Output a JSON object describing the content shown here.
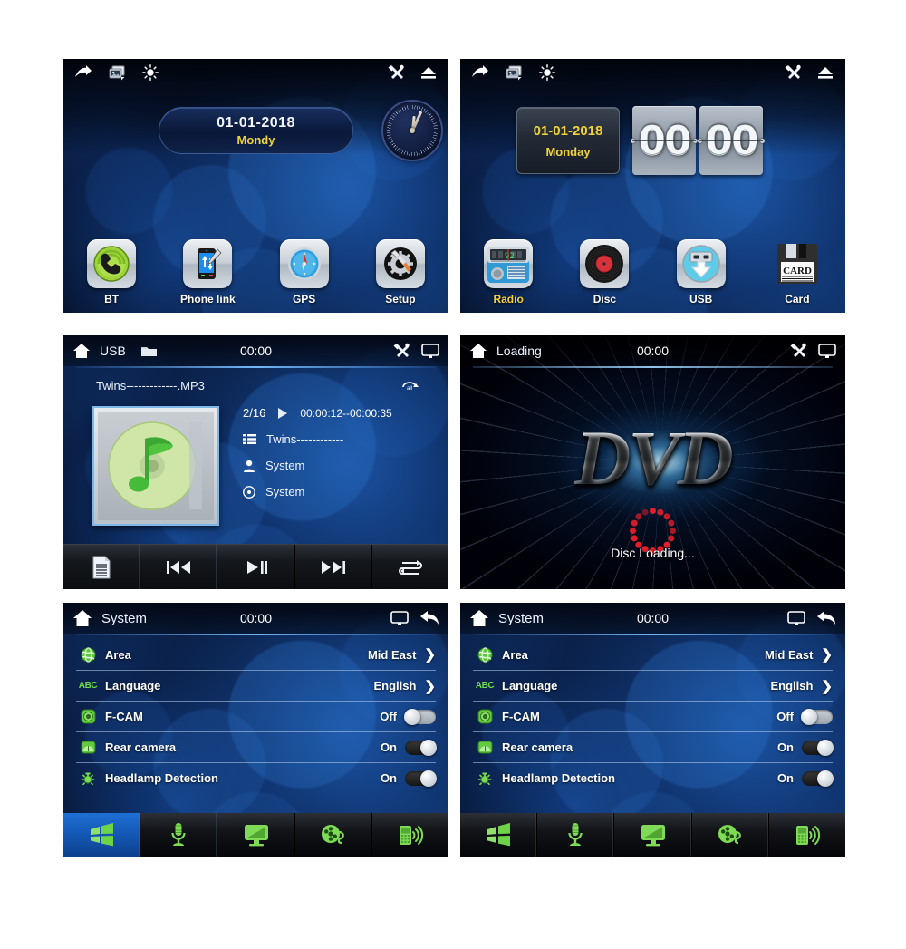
{
  "panels": {
    "home1": {
      "statusbar": {
        "icons_left": [
          "share-arrow-icon",
          "gallery-icon",
          "brightness-icon"
        ],
        "icons_right": [
          "tools-icon",
          "eject-icon"
        ]
      },
      "date": "01-01-2018",
      "day": "Mondy",
      "apps": [
        {
          "label": "BT",
          "icon": "bluetooth-phone-icon",
          "selected": false
        },
        {
          "label": "Phone link",
          "icon": "phone-link-icon",
          "selected": false
        },
        {
          "label": "GPS",
          "icon": "compass-icon",
          "selected": false
        },
        {
          "label": "Setup",
          "icon": "gear-hammer-icon",
          "selected": false
        }
      ]
    },
    "home2": {
      "date": "01-01-2018",
      "day": "Monday",
      "flip_hours": "00",
      "flip_minutes": "00",
      "apps": [
        {
          "label": "Radio",
          "icon": "radio-icon",
          "selected": true
        },
        {
          "label": "Disc",
          "icon": "vinyl-disc-icon",
          "selected": false
        },
        {
          "label": "USB",
          "icon": "usb-icon",
          "selected": false
        },
        {
          "label": "Card",
          "icon": "sd-card-icon",
          "selected": false
        }
      ]
    },
    "music": {
      "header": {
        "source": "USB",
        "clock": "00:00",
        "folder_icon": "folder-icon"
      },
      "file_name": "Twins-------------.MP3",
      "track_index": "2/16",
      "time_range": "00:00:12--00:00:35",
      "title": "Twins------------",
      "artist": "System",
      "album": "System",
      "transport": [
        "list-icon",
        "previous-track-icon",
        "play-pause-icon",
        "next-track-icon",
        "repeat-icon"
      ]
    },
    "dvd": {
      "header": {
        "title": "Loading",
        "clock": "00:00"
      },
      "logo": "DVD",
      "status": "Disc Loading..."
    },
    "system_left": {
      "header": {
        "title": "System",
        "clock": "00:00"
      },
      "rows": [
        {
          "icon": "globe-icon",
          "label": "Area",
          "value": "Mid East",
          "control": "chevron"
        },
        {
          "icon": "abc-icon",
          "label": "Language",
          "value": "English",
          "control": "chevron"
        },
        {
          "icon": "front-camera-icon",
          "label": "F-CAM",
          "value": "Off",
          "control": "toggle-off"
        },
        {
          "icon": "rear-camera-icon",
          "label": "Rear camera",
          "value": "On",
          "control": "toggle-on"
        },
        {
          "icon": "headlamp-icon",
          "label": "Headlamp Detection",
          "value": "On",
          "control": "toggle-on"
        }
      ],
      "tabs": [
        {
          "icon": "windows-icon",
          "active": true
        },
        {
          "icon": "microphone-icon",
          "active": false
        },
        {
          "icon": "display-icon",
          "active": false
        },
        {
          "icon": "film-reel-icon",
          "active": false
        },
        {
          "icon": "mobile-signal-icon",
          "active": false
        }
      ]
    },
    "system_right": {
      "header": {
        "title": "System",
        "clock": "00:00"
      },
      "rows": [
        {
          "icon": "globe-icon",
          "label": "Area",
          "value": "Mid East",
          "control": "chevron"
        },
        {
          "icon": "abc-icon",
          "label": "Language",
          "value": "English",
          "control": "chevron"
        },
        {
          "icon": "front-camera-icon",
          "label": "F-CAM",
          "value": "Off",
          "control": "toggle-off"
        },
        {
          "icon": "rear-camera-icon",
          "label": "Rear camera",
          "value": "On",
          "control": "toggle-on"
        },
        {
          "icon": "headlamp-icon",
          "label": "Headlamp Detection",
          "value": "On",
          "control": "toggle-on"
        }
      ],
      "tabs": [
        {
          "icon": "windows-icon",
          "active": false
        },
        {
          "icon": "microphone-icon",
          "active": false
        },
        {
          "icon": "display-icon",
          "active": false
        },
        {
          "icon": "film-reel-icon",
          "active": false
        },
        {
          "icon": "mobile-signal-icon",
          "active": false
        }
      ]
    }
  },
  "colors": {
    "accent_yellow": "#f2d23a",
    "accent_blue": "#1f6fd4",
    "icon_green": "#6fdc4a",
    "spinner_red": "#e31d2a"
  }
}
